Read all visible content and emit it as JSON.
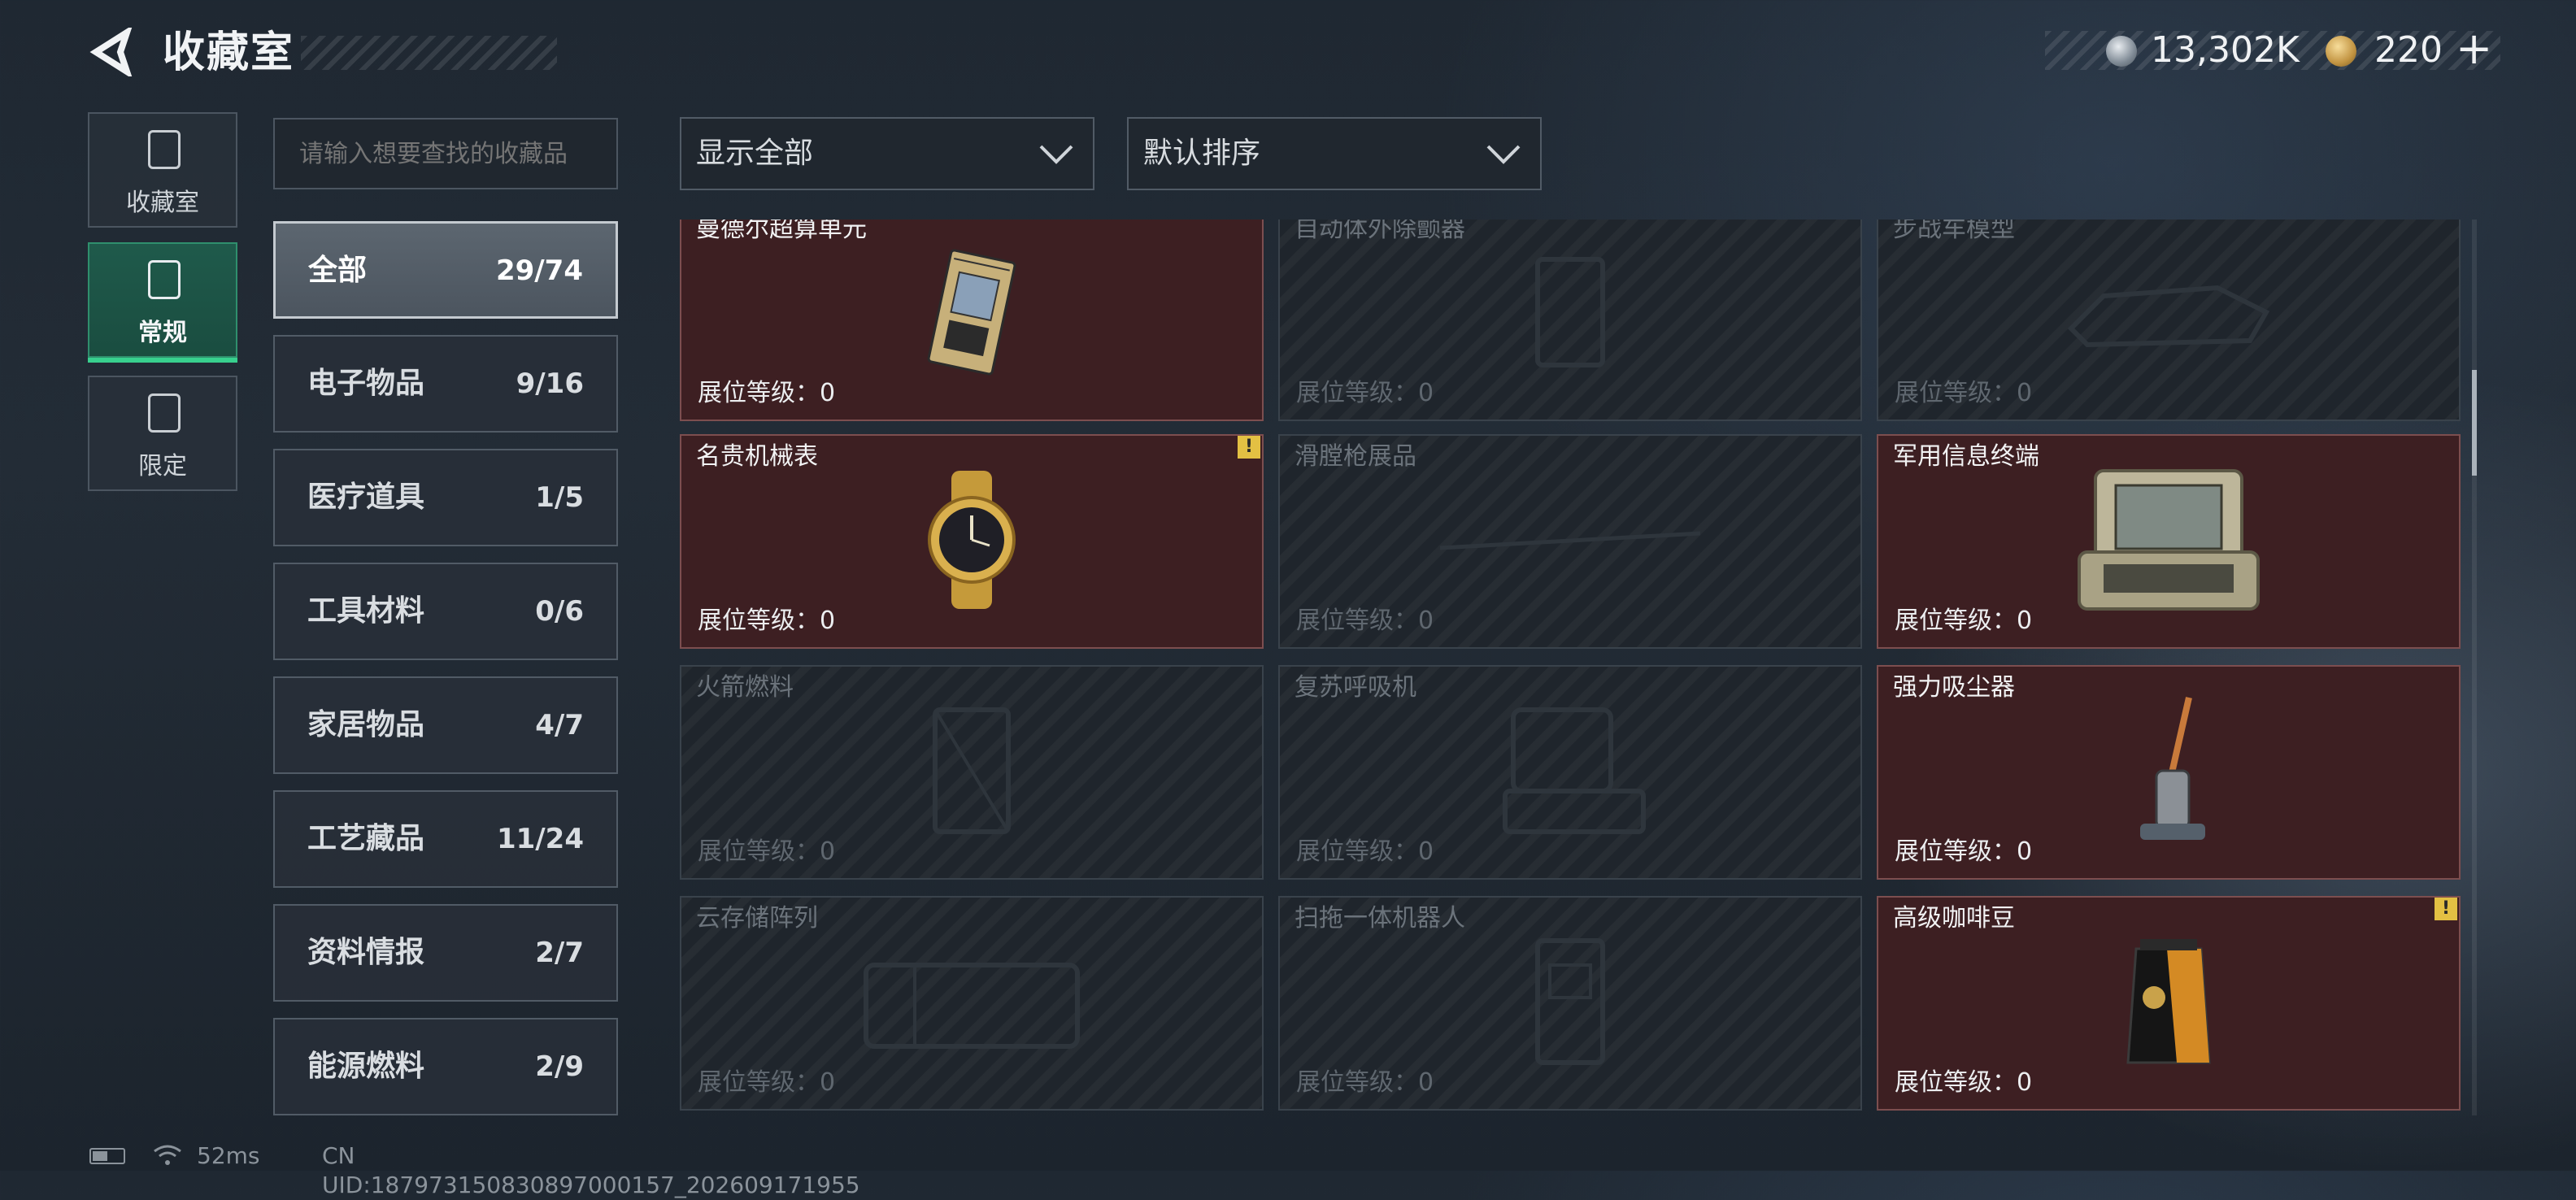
{
  "header": {
    "title": "收藏室",
    "currencies": [
      {
        "icon": "silver-coin-icon",
        "value": "13,302K"
      },
      {
        "icon": "gold-coin-icon",
        "value": "220"
      }
    ],
    "add_label": "+"
  },
  "side_nav": [
    {
      "label": "收藏室",
      "icon": "collection-room-icon"
    },
    {
      "label": "常规",
      "icon": "regular-card-icon",
      "active": true
    },
    {
      "label": "限定",
      "icon": "limited-card-icon"
    }
  ],
  "search": {
    "placeholder": "请输入想要查找的收藏品"
  },
  "categories": [
    {
      "name": "全部",
      "count": "29/74",
      "active": true
    },
    {
      "name": "电子物品",
      "count": "9/16"
    },
    {
      "name": "医疗道具",
      "count": "1/5"
    },
    {
      "name": "工具材料",
      "count": "0/6"
    },
    {
      "name": "家居物品",
      "count": "4/7"
    },
    {
      "name": "工艺藏品",
      "count": "11/24"
    },
    {
      "name": "资料情报",
      "count": "2/7"
    },
    {
      "name": "能源燃料",
      "count": "2/9"
    }
  ],
  "filters": {
    "display": "显示全部",
    "sort": "默认排序"
  },
  "items": [
    {
      "name": "曼德尔超算单元",
      "level": "展位等级：0",
      "owned": true,
      "alert": false,
      "icon": "supercomputer-unit-icon"
    },
    {
      "name": "自动体外除颤器",
      "level": "展位等级：0",
      "owned": false,
      "alert": false,
      "icon": "defibrillator-icon"
    },
    {
      "name": "步战车模型",
      "level": "展位等级：0",
      "owned": false,
      "alert": false,
      "icon": "ifv-model-icon"
    },
    {
      "name": "名贵机械表",
      "level": "展位等级：0",
      "owned": true,
      "alert": true,
      "icon": "watch-icon"
    },
    {
      "name": "滑膛枪展品",
      "level": "展位等级：0",
      "owned": false,
      "alert": false,
      "icon": "musket-icon"
    },
    {
      "name": "军用信息终端",
      "level": "展位等级：0",
      "owned": true,
      "alert": false,
      "icon": "military-terminal-icon"
    },
    {
      "name": "火箭燃料",
      "level": "展位等级：0",
      "owned": false,
      "alert": false,
      "icon": "rocket-fuel-icon"
    },
    {
      "name": "复苏呼吸机",
      "level": "展位等级：0",
      "owned": false,
      "alert": false,
      "icon": "ventilator-icon"
    },
    {
      "name": "强力吸尘器",
      "level": "展位等级：0",
      "owned": true,
      "alert": false,
      "icon": "vacuum-cleaner-icon"
    },
    {
      "name": "云存储阵列",
      "level": "展位等级：0",
      "owned": false,
      "alert": false,
      "icon": "storage-array-icon"
    },
    {
      "name": "扫拖一体机器人",
      "level": "展位等级：0",
      "owned": false,
      "alert": false,
      "icon": "mop-robot-icon"
    },
    {
      "name": "高级咖啡豆",
      "level": "展位等级：0",
      "owned": true,
      "alert": true,
      "icon": "coffee-bag-icon"
    }
  ],
  "alert_symbol": "!",
  "status_bar": {
    "ping": "52ms",
    "uid": "CN UID:187973150830897000157_202609171955"
  }
}
